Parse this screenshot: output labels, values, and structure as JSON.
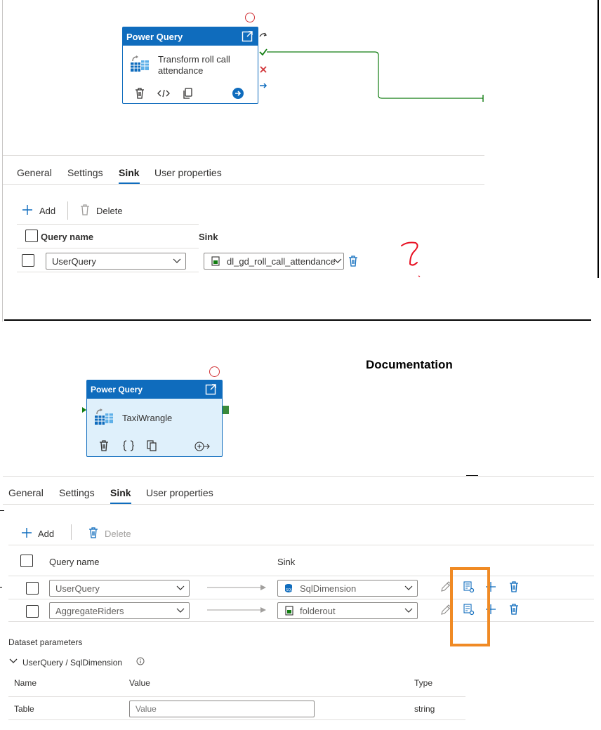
{
  "top": {
    "card": {
      "title": "Power Query",
      "name": "Transform roll call attendance"
    },
    "tabs": [
      "General",
      "Settings",
      "Sink",
      "User properties"
    ],
    "toolbar": {
      "add": "Add",
      "delete": "Delete"
    },
    "columns": {
      "query": "Query name",
      "sink": "Sink"
    },
    "rows": [
      {
        "query": "UserQuery",
        "sink": "dl_gd_roll_call_attendance"
      }
    ],
    "annotation": "?"
  },
  "bottom": {
    "heading": "Documentation",
    "card": {
      "title": "Power Query",
      "name": "TaxiWrangle"
    },
    "tabs": [
      "General",
      "Settings",
      "Sink",
      "User properties"
    ],
    "toolbar": {
      "add": "Add",
      "delete": "Delete"
    },
    "columns": {
      "query": "Query name",
      "sink": "Sink"
    },
    "rows": [
      {
        "query": "UserQuery",
        "sink": "SqlDimension"
      },
      {
        "query": "AggregateRiders",
        "sink": "folderout"
      }
    ],
    "dataset": {
      "title": "Dataset parameters",
      "group": "UserQuery / SqlDimension",
      "columns": {
        "name": "Name",
        "value": "Value",
        "type": "Type"
      },
      "row": {
        "name": "Table",
        "placeholder": "Value",
        "type": "string"
      }
    }
  },
  "colors": {
    "accent": "#0f6cbd",
    "highlight": "#f08a24",
    "success": "#107c10",
    "error": "#d13438"
  }
}
